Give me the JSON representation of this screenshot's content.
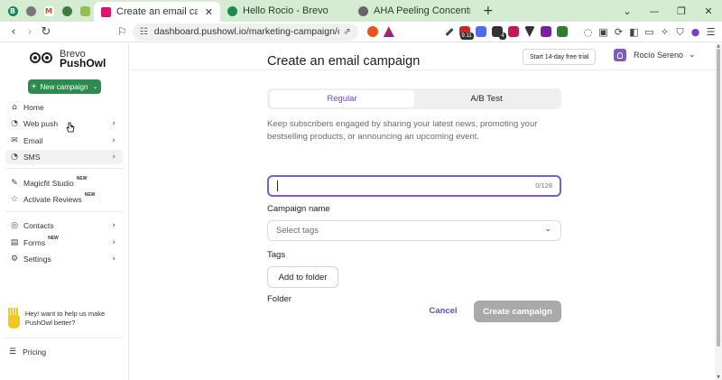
{
  "browser": {
    "tabs": [
      {
        "label": "Create an email campaign - Push",
        "close": "✕",
        "active": true,
        "favicon_color": "#d9156f"
      },
      {
        "label": "Hello Rocio - Brevo",
        "active": false,
        "favicon_color": "#1b8a56"
      },
      {
        "label": "AHA Peeling Concentrate - Exfoliati",
        "active": false,
        "favicon_color": "#666666"
      }
    ],
    "pinned_tabs": [
      {
        "icon": "brevo-icon",
        "glyph": "B",
        "color": "#0c8a53"
      },
      {
        "icon": "chrome-icon",
        "glyph": "",
        "color": "#777777"
      },
      {
        "icon": "gmail-icon",
        "glyph": "M",
        "color": "#d44638"
      },
      {
        "icon": "globe-icon",
        "glyph": "",
        "color": "#3f7d3f"
      },
      {
        "icon": "shopify-icon",
        "glyph": "",
        "color": "#95bf47"
      }
    ],
    "new_tab": "+",
    "window_controls": [
      "⌄",
      "—",
      "❐",
      "✕"
    ],
    "url": "dashboard.pushowl.io/marketing-campaign/campaign-...",
    "nav": [
      "‹",
      "›",
      "↻"
    ],
    "extensions": [
      {
        "name": "pen-icon",
        "color": "#444444"
      },
      {
        "name": "ext-red-icon",
        "color": "#c62828",
        "badge": "9.11"
      },
      {
        "name": "ext-m-icon",
        "color": "#4a6cf7"
      },
      {
        "name": "ext-layers-icon",
        "color": "#333333",
        "badge": "4"
      },
      {
        "name": "ext-download-icon",
        "color": "#c2185b"
      },
      {
        "name": "ext-arrow-icon",
        "color": "#333333"
      },
      {
        "name": "ext-shield-icon",
        "color": "#7b1fa2"
      },
      {
        "name": "ext-s-icon",
        "color": "#2e7d32"
      }
    ],
    "toolbar_icons": [
      "chat-icon",
      "calendar-icon",
      "sync-icon",
      "sidebar-icon",
      "wallet-icon",
      "sparkle-icon",
      "shield-icon",
      "profile-icon",
      "menu-icon"
    ]
  },
  "sidebar": {
    "brand": {
      "line1": "Brevo",
      "line2": "PushOwl"
    },
    "new_campaign": {
      "plus": "+",
      "label": "New campaign",
      "caret": "⌄"
    },
    "items": [
      {
        "label": "Home",
        "icon": "home-icon",
        "glyph": "⌂",
        "chevron": ""
      },
      {
        "label": "Web push",
        "icon": "bell-icon",
        "glyph": "♫",
        "chevron": "›"
      },
      {
        "label": "Email",
        "icon": "mail-icon",
        "glyph": "✉",
        "chevron": "›"
      },
      {
        "label": "SMS",
        "icon": "message-icon",
        "glyph": "◔",
        "chevron": "›"
      },
      {
        "label": "Magicfit Studio",
        "icon": "magic-icon",
        "glyph": "✎",
        "chevron": "",
        "tag": "NEW"
      },
      {
        "label": "Activate Reviews",
        "icon": "star-icon",
        "glyph": "☆",
        "chevron": "",
        "tag": "NEW"
      },
      {
        "label": "Contacts",
        "icon": "contacts-icon",
        "glyph": "◎",
        "chevron": "›"
      },
      {
        "label": "Forms",
        "icon": "forms-icon",
        "glyph": "▤",
        "chevron": "›",
        "tag": "NEW"
      },
      {
        "label": "Settings",
        "icon": "gear-icon",
        "glyph": "⚙",
        "chevron": "›"
      }
    ],
    "feedback_text": "Hey! want to help us make PushOwl better?",
    "pricing": {
      "label": "Pricing",
      "glyph": "☰"
    }
  },
  "header": {
    "trial_button": "Start 14-day free trial",
    "user_name": "Rocío Sereno",
    "user_caret": "⌄"
  },
  "form": {
    "title": "Create an email campaign",
    "toggle": {
      "left": "Regular",
      "right": "A/B Test",
      "selected": "Regular"
    },
    "description": "Keep subscribers engaged by sharing your latest news, promoting your bestselling products, or announcing an upcoming event.",
    "campaign_name": {
      "label": "Campaign name",
      "value": "",
      "counter": "0/128"
    },
    "tags": {
      "label": "Tags",
      "placeholder": "Select tags",
      "caret": "⌄"
    },
    "folder": {
      "label": "Folder",
      "button": "Add to folder"
    },
    "cancel": "Cancel",
    "submit": "Create campaign"
  },
  "colors": {
    "accent": "#6a48c7",
    "brand_green": "#2e8a4e",
    "disabled": "#a9a9a9",
    "tabbar": "#d6ecd2"
  }
}
